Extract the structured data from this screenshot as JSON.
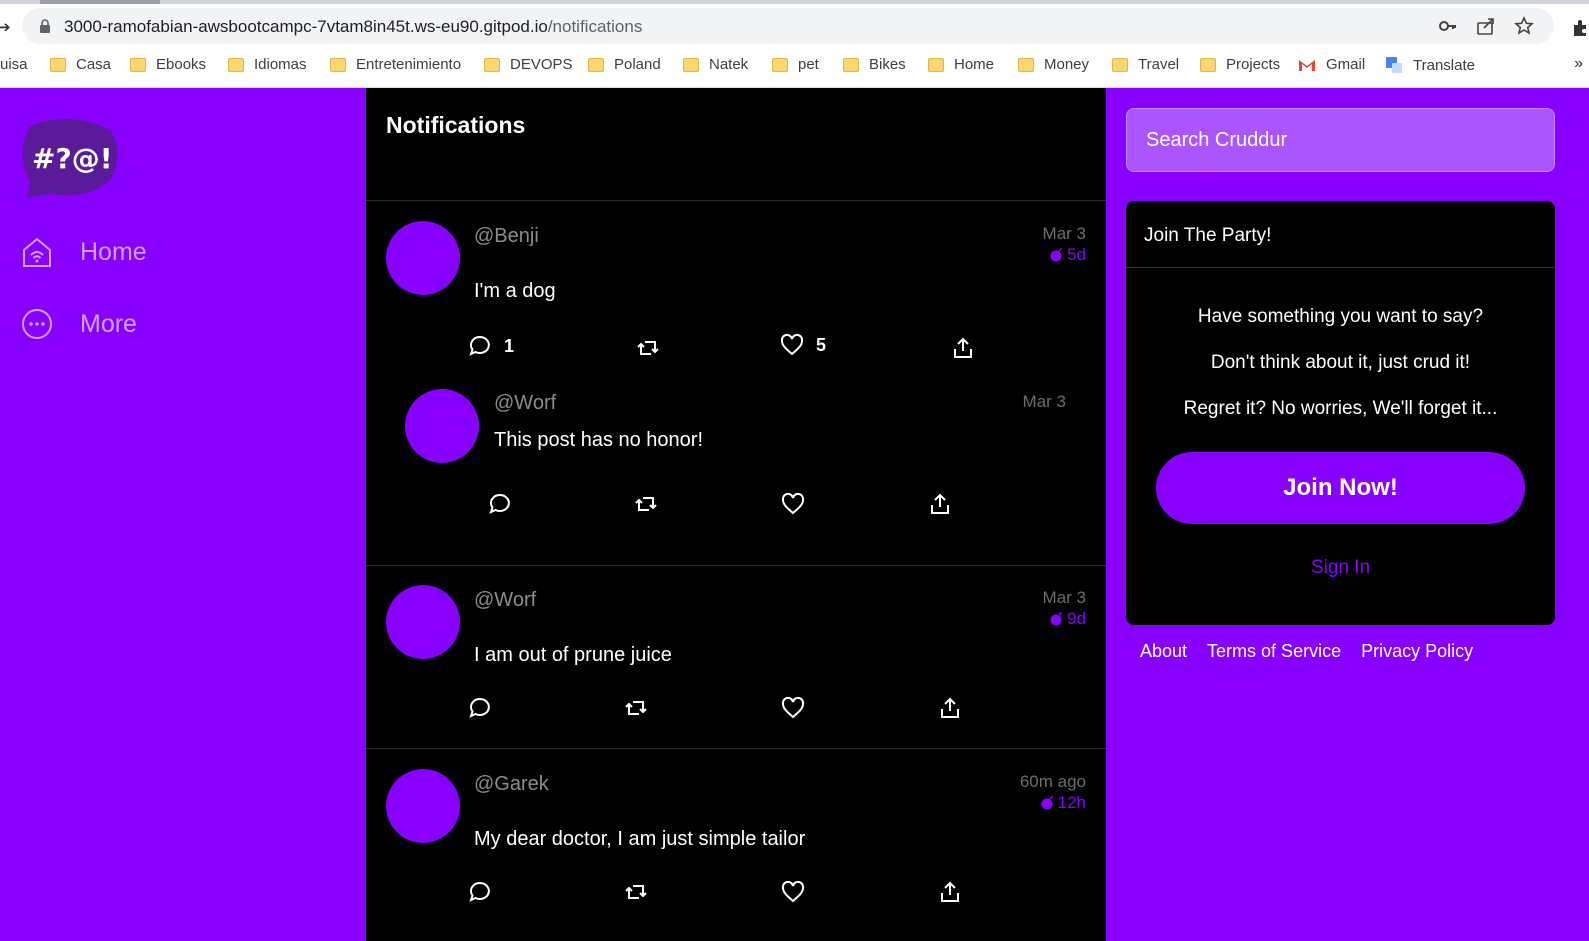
{
  "browser": {
    "url_host": "3000-ramofabian-awsbootcampc-7vtam8in45t.ws-eu90.gitpod.io",
    "url_path": "/notifications",
    "bookmarks": [
      "uisa",
      "Casa",
      "Ebooks",
      "Idiomas",
      "Entretenimiento",
      "DEVOPS",
      "Poland",
      "Natek",
      "pet",
      "Bikes",
      "Home",
      "Money",
      "Travel",
      "Projects",
      "Gmail",
      "Translate"
    ]
  },
  "sidebar": {
    "logo_text": "#?@!",
    "items": [
      {
        "label": "Home",
        "icon": "home-icon"
      },
      {
        "label": "More",
        "icon": "more-icon"
      }
    ]
  },
  "feed": {
    "title": "Notifications",
    "posts": [
      {
        "handle": "@Benji",
        "message": "I'm a dog",
        "when": "Mar 3",
        "expires": "5d",
        "replies": "1",
        "likes": "5"
      },
      {
        "handle": "@Worf",
        "message": "This post has no honor!",
        "when": "Mar 3",
        "expires": "",
        "replies": "",
        "likes": ""
      },
      {
        "handle": "@Worf",
        "message": "I am out of prune juice",
        "when": "Mar 3",
        "expires": "9d",
        "replies": "",
        "likes": ""
      },
      {
        "handle": "@Garek",
        "message": "My dear doctor, I am just simple tailor",
        "when": "60m ago",
        "expires": "12h",
        "replies": "",
        "likes": ""
      }
    ]
  },
  "right": {
    "search_placeholder": "Search Cruddur",
    "party": {
      "title": "Join The Party!",
      "lines": [
        "Have something you want to say?",
        "Don't think about it, just crud it!",
        "Regret it? No worries, We'll forget it..."
      ],
      "join_label": "Join Now!",
      "signin_label": "Sign In"
    },
    "footer": [
      "About",
      "Terms of Service",
      "Privacy Policy"
    ]
  },
  "colors": {
    "accent": "#8800ff",
    "feed_bg": "#000000"
  }
}
